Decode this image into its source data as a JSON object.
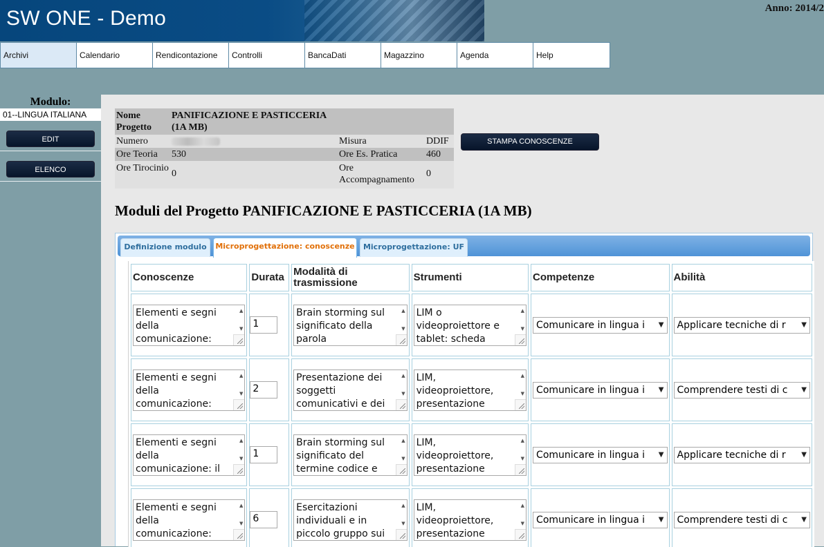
{
  "header": {
    "app_title": "SW ONE - Demo",
    "anno": "Anno: 2014/2"
  },
  "menu": {
    "items": [
      "Archivi",
      "Calendario",
      "Rendicontazione",
      "Controlli",
      "BancaDati",
      "Magazzino",
      "Agenda",
      "Help"
    ]
  },
  "sidebar": {
    "modulo_label": "Modulo:",
    "modulo_value": "01--LINGUA ITALIANA",
    "edit_label": "EDIT",
    "elenco_label": "ELENCO"
  },
  "info": {
    "nome_label": "Nome Progetto",
    "nome_value": "PANIFICAZIONE E PASTICCERIA (1A MB)",
    "numero_label": "Numero",
    "misura_label": "Misura",
    "misura_value": "DDIF",
    "ore_teoria_label": "Ore Teoria",
    "ore_teoria_value": "530",
    "ore_pratica_label": "Ore Es. Pratica",
    "ore_pratica_value": "460",
    "ore_tirocinio_label": "Ore Tirocinio",
    "ore_tirocinio_value": "0",
    "ore_accomp_label": "Ore Accompagnamento",
    "ore_accomp_value": "0",
    "stampa_label": "STAMPA CONOSCENZE"
  },
  "section": {
    "title": "Moduli del Progetto PANIFICAZIONE E PASTICCERIA (1A MB)"
  },
  "tabs": [
    {
      "label": "Definizione modulo"
    },
    {
      "label": "Microprogettazione: conoscenze"
    },
    {
      "label": "Microprogettazione: UF"
    }
  ],
  "table": {
    "headers": [
      "Conoscenze",
      "Durata",
      "Modalità di trasmissione",
      "Strumenti",
      "Competenze",
      "Abilità"
    ],
    "rows": [
      {
        "conoscenze": "Elementi e segni della comunicazione:",
        "durata": "1",
        "modalita": "Brain storming sul significato della parola",
        "strumenti": "LIM o videoproiettore e tablet: scheda",
        "competenze": "Comunicare in lingua i",
        "abilita": "Applicare tecniche di r"
      },
      {
        "conoscenze": "Elementi e segni della comunicazione:",
        "durata": "2",
        "modalita": "Presentazione dei soggetti comunicativi e dei",
        "strumenti": "LIM, videoproiettore, presentazione",
        "competenze": "Comunicare in lingua i",
        "abilita": "Comprendere testi di c"
      },
      {
        "conoscenze": "Elementi e segni della comunicazione: il",
        "durata": "1",
        "modalita": "Brain storming sul significato del termine codice e",
        "strumenti": "LIM, videoproiettore, presentazione",
        "competenze": "Comunicare in lingua i",
        "abilita": "Applicare tecniche di r"
      },
      {
        "conoscenze": "Elementi e segni della comunicazione:",
        "durata": "6",
        "modalita": "Esercitazioni individuali e in piccolo gruppo sui",
        "strumenti": "LIM, videoproiettore, presentazione",
        "competenze": "Comunicare in lingua i",
        "abilita": "Comprendere testi di c"
      }
    ]
  }
}
